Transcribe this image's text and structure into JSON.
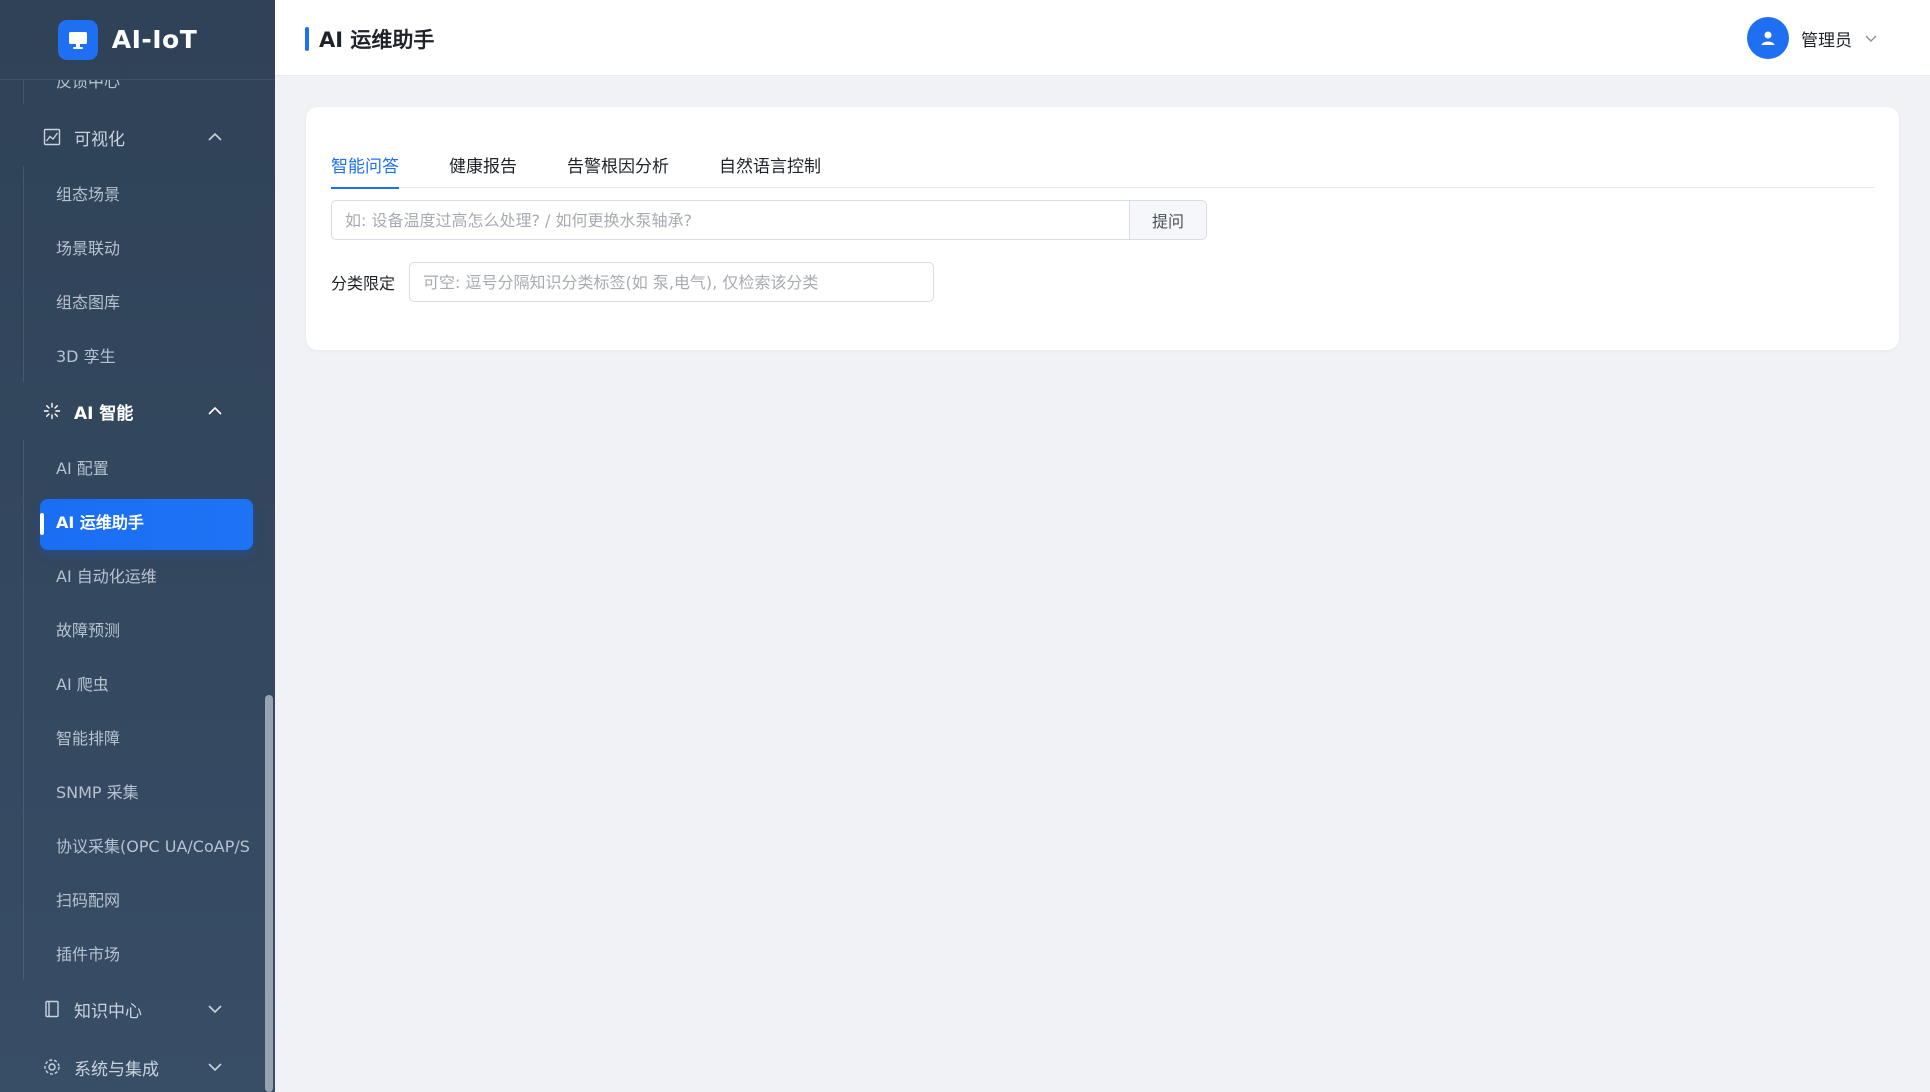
{
  "brand": {
    "title": "AI-IoT",
    "icon": "monitor-icon"
  },
  "header": {
    "title": "AI 运维助手",
    "user_name": "管理员"
  },
  "sidebar": {
    "top_item": "反馈中心",
    "groups": [
      {
        "label": "可视化",
        "icon": "chart-image-icon",
        "expanded": true,
        "items": [
          "组态场景",
          "场景联动",
          "组态图库",
          "3D 孪生"
        ]
      },
      {
        "label": "AI 智能",
        "icon": "ai-spark-icon",
        "expanded": true,
        "items": [
          "AI 配置",
          "AI 运维助手",
          "AI 自动化运维",
          "故障预测",
          "AI 爬虫",
          "智能排障",
          "SNMP 采集",
          "协议采集(OPC UA/CoAP/S",
          "扫码配网",
          "插件市场"
        ]
      },
      {
        "label": "知识中心",
        "icon": "book-icon",
        "expanded": false
      },
      {
        "label": "系统与集成",
        "icon": "gear-icon",
        "expanded": false
      }
    ],
    "selected_item": "AI 运维助手"
  },
  "tabs": [
    {
      "label": "智能问答",
      "active": true
    },
    {
      "label": "健康报告",
      "active": false
    },
    {
      "label": "告警根因分析",
      "active": false
    },
    {
      "label": "自然语言控制",
      "active": false
    }
  ],
  "ask": {
    "placeholder": "如: 设备温度过高怎么处理? / 如何更换水泵轴承?",
    "button_label": "提问"
  },
  "filter": {
    "label": "分类限定",
    "placeholder": "可空: 逗号分隔知识分类标签(如 泵,电气), 仅检索该分类"
  },
  "colors": {
    "accent": "#1e6ff2",
    "sidebar_bg": "#33475e",
    "page_bg": "#f0f2f5"
  }
}
